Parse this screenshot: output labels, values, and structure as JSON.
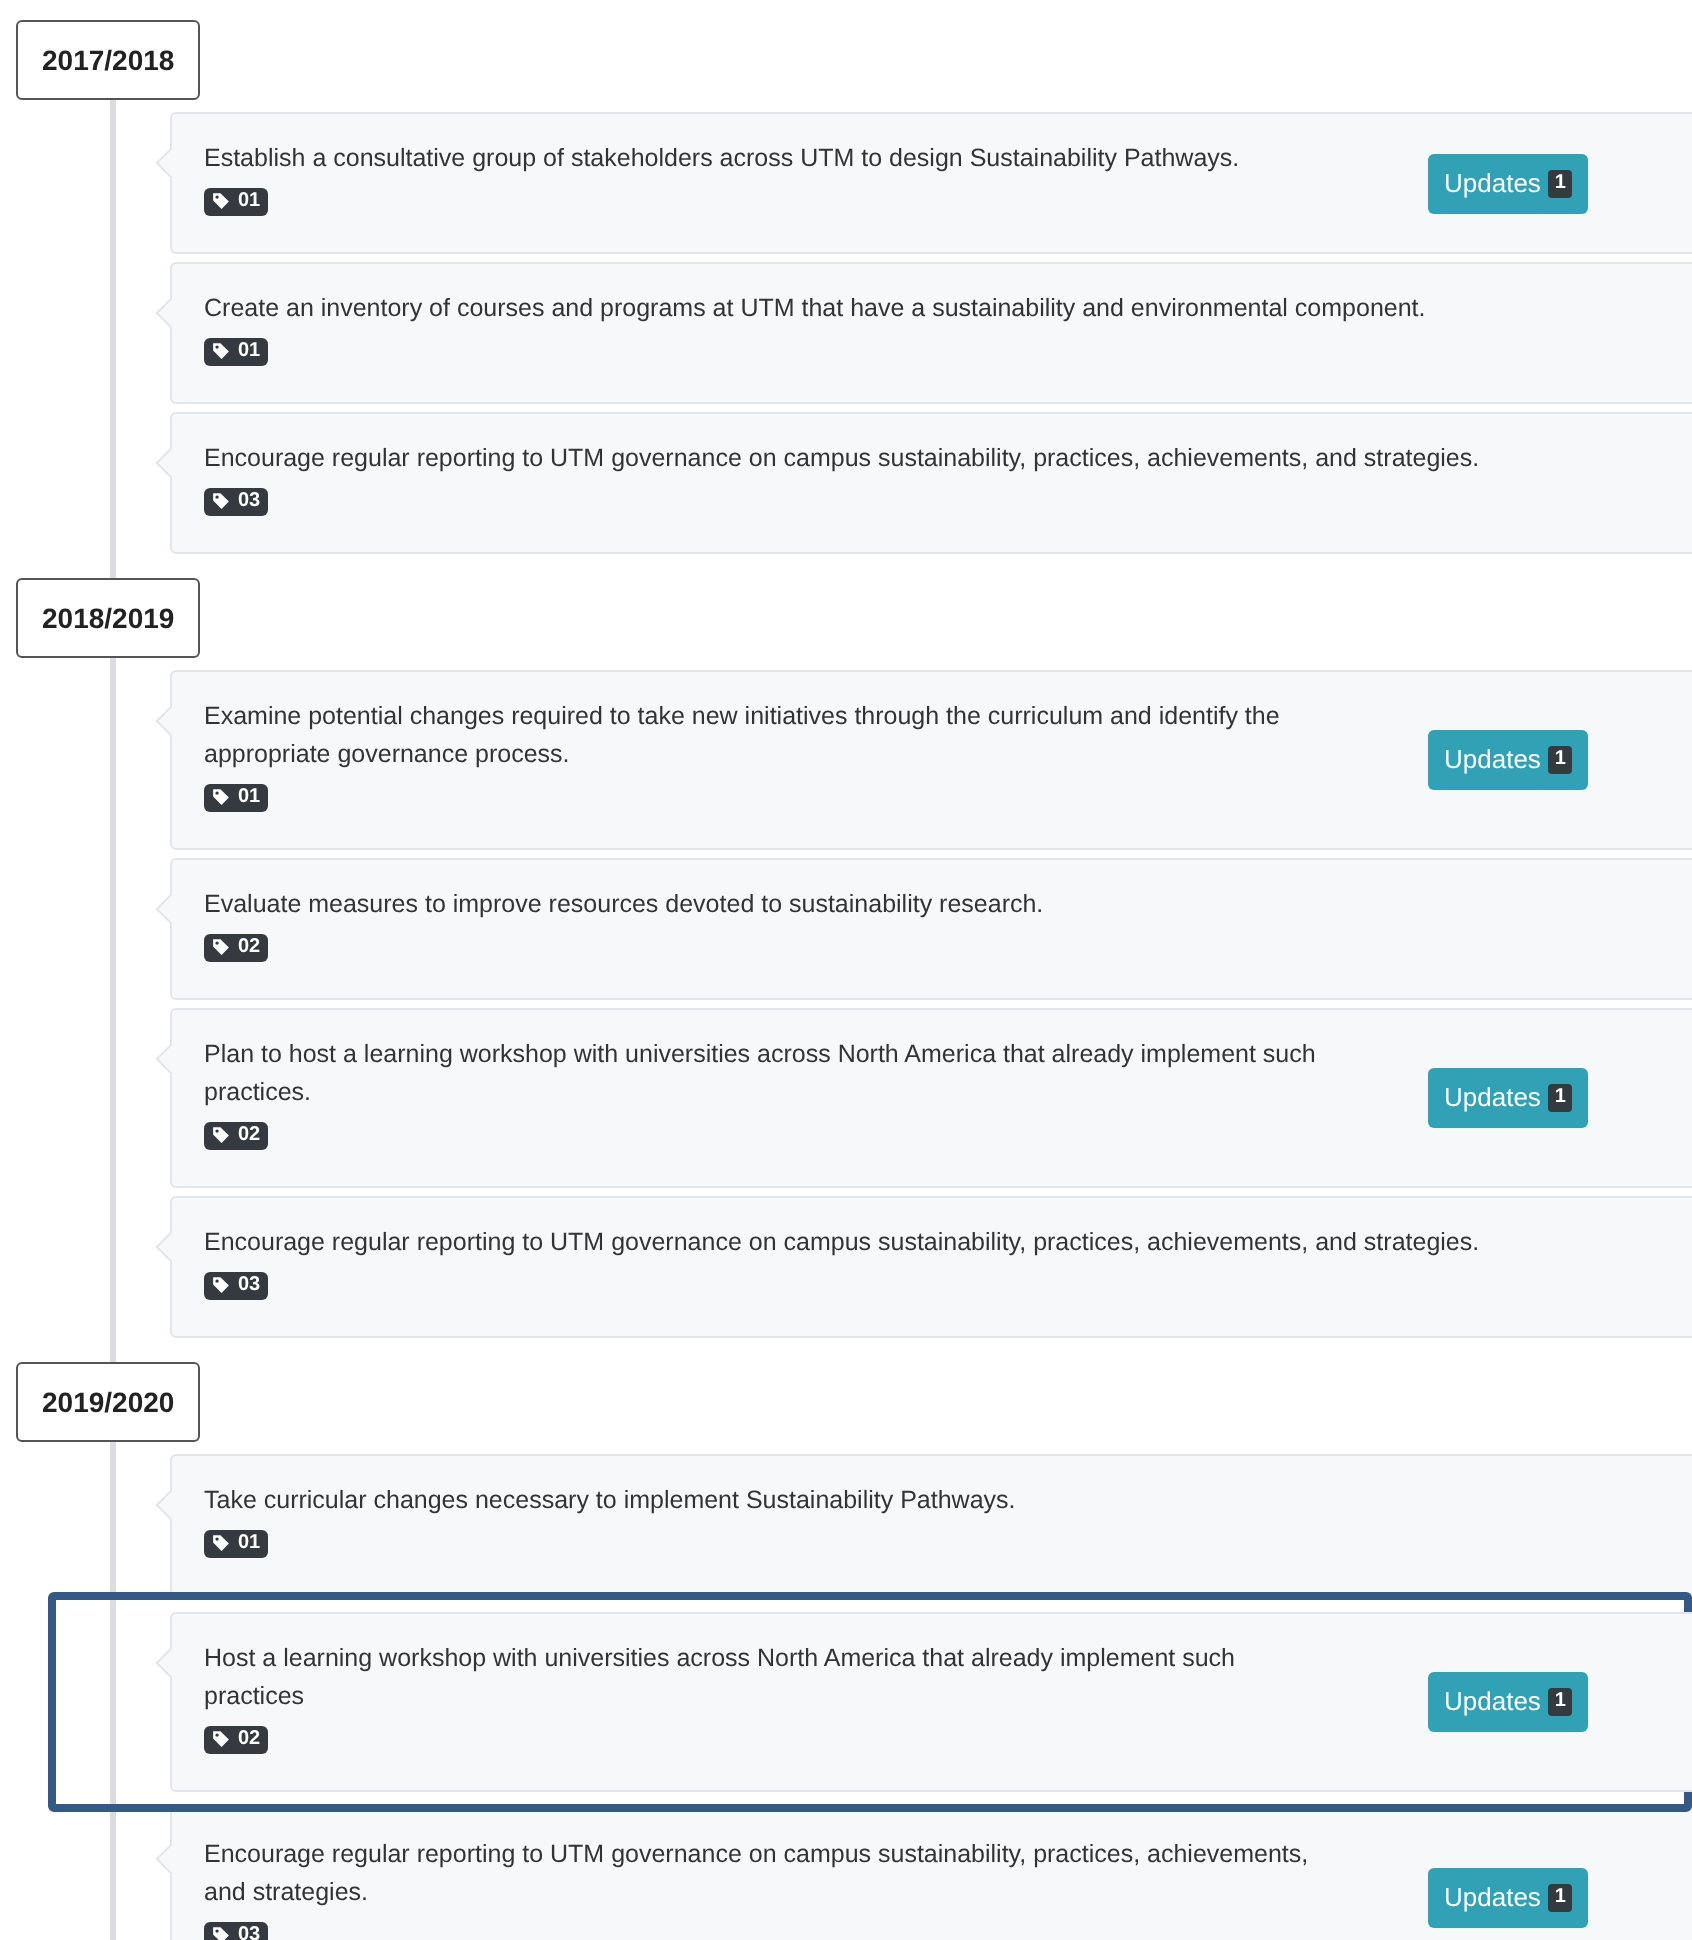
{
  "sections": [
    {
      "year": "2017/2018",
      "items": [
        {
          "text": "Establish a consultative group of stakeholders across UTM to design Sustainability Pathways.",
          "tag": "01",
          "updates": {
            "label": "Updates",
            "count": "1"
          },
          "highlighted": false
        },
        {
          "text": "Create an inventory of courses and programs at UTM that have a sustainability and environmental component.",
          "tag": "01",
          "highlighted": false
        },
        {
          "text": "Encourage regular reporting to UTM governance on campus sustainability, practices, achievements, and strategies.",
          "tag": "03",
          "highlighted": false
        }
      ]
    },
    {
      "year": "2018/2019",
      "items": [
        {
          "text": "Examine potential changes required to take new initiatives through the curriculum and identify the appropriate governance process.",
          "tag": "01",
          "updates": {
            "label": "Updates",
            "count": "1"
          },
          "highlighted": false
        },
        {
          "text": "Evaluate measures to improve resources devoted to sustainability research.",
          "tag": "02",
          "highlighted": false
        },
        {
          "text": "Plan to host a learning workshop with universities across North America that already implement such practices.",
          "tag": "02",
          "updates": {
            "label": "Updates",
            "count": "1"
          },
          "highlighted": false
        },
        {
          "text": "Encourage regular reporting to UTM governance on campus sustainability, practices, achievements, and strategies.",
          "tag": "03",
          "highlighted": false
        }
      ]
    },
    {
      "year": "2019/2020",
      "items": [
        {
          "text": "Take curricular changes necessary to implement Sustainability Pathways.",
          "tag": "01",
          "highlighted": false
        },
        {
          "text": "Host a learning workshop with universities across North America that already implement such practices",
          "tag": "02",
          "updates": {
            "label": "Updates",
            "count": "1"
          },
          "highlighted": true
        },
        {
          "text": "Encourage regular reporting to UTM governance on campus sustainability, practices, achievements, and strategies.",
          "tag": "03",
          "updates": {
            "label": "Updates",
            "count": "1"
          },
          "highlighted": false
        }
      ]
    }
  ]
}
